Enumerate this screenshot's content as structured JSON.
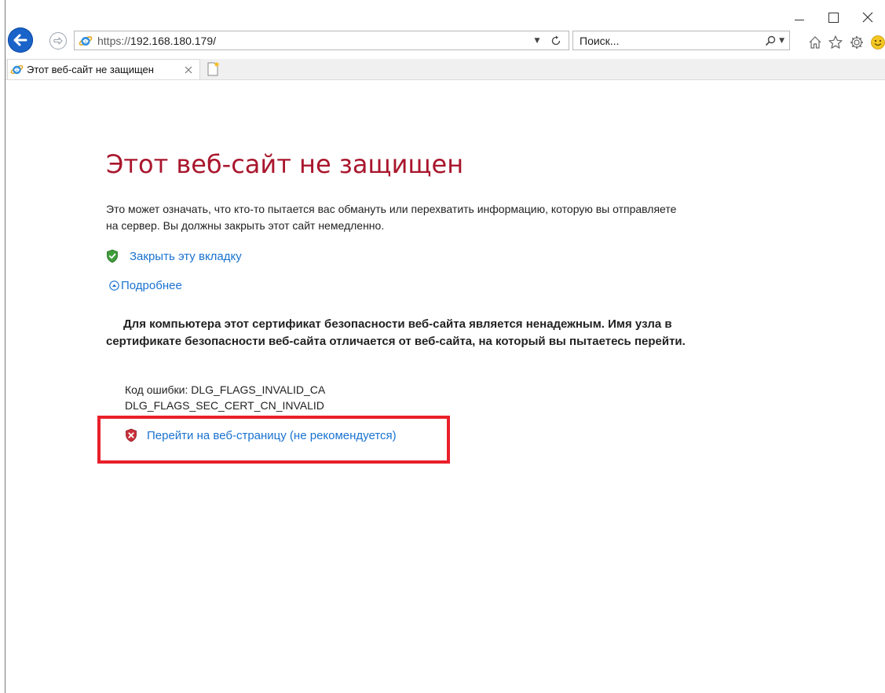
{
  "window": {
    "controls": [
      "minimize",
      "maximize",
      "close"
    ]
  },
  "nav": {
    "address_scheme": "https://",
    "address_host": "192.168.180.179/",
    "search_placeholder": "Поиск..."
  },
  "tab": {
    "label": "Этот веб-сайт не защищен"
  },
  "page": {
    "title": "Этот веб-сайт не защищен",
    "description": "Это может означать, что кто-то пытается вас обмануть или перехватить информацию, которую вы отправляете на сервер. Вы должны закрыть этот сайт немедленно.",
    "close_tab_link": "Закрыть эту вкладку",
    "details_link": "Подробнее",
    "warning_bold": "Для компьютера этот сертификат безопасности веб-сайта является ненадежным. Имя узла в сертификате безопасности веб-сайта отличается от веб-сайта, на который вы пытаетесь перейти.",
    "error_code_line1": "Код ошибки: DLG_FLAGS_INVALID_CA",
    "error_code_line2": "DLG_FLAGS_SEC_CERT_CN_INVALID",
    "proceed_link": "Перейти на веб-страницу (не рекомендуется)"
  },
  "colors": {
    "title_red": "#a9162d",
    "link_blue": "#1a73d0",
    "highlight_red": "#e8202a",
    "back_button_blue": "#1a63c9"
  },
  "icons": [
    "back-arrow-icon",
    "forward-arrow-icon",
    "ie-logo-icon",
    "refresh-icon",
    "search-icon",
    "home-icon",
    "star-icon",
    "gear-icon",
    "smiley-icon",
    "green-shield-icon",
    "red-shield-icon",
    "chevron-up-icon",
    "close-icon",
    "new-tab-icon"
  ]
}
